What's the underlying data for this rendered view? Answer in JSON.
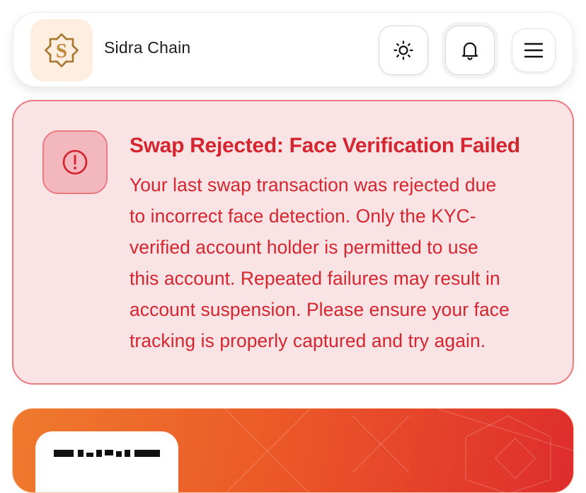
{
  "header": {
    "app_name": "Sidra Chain",
    "logo_icon": "sidra-star-logo-icon",
    "buttons": [
      {
        "name": "theme-toggle",
        "icon": "sun-icon"
      },
      {
        "name": "notifications",
        "icon": "bell-icon"
      },
      {
        "name": "menu",
        "icon": "hamburger-menu-icon"
      }
    ]
  },
  "alert": {
    "icon": "exclamation-circle-icon",
    "title": "Swap Rejected: Face Verification Failed",
    "body_lines": [
      "Your last swap transaction was rejected due",
      "to incorrect face detection. Only the KYC-",
      "verified account holder is permitted to use",
      "this account. Repeated failures may result in",
      "account suspension. Please ensure your face",
      "tracking is properly captured and try again."
    ]
  },
  "card": {
    "icon": "qr-code-icon"
  },
  "colors": {
    "alert_text": "#d42630",
    "alert_bg": "#fae3e4",
    "alert_border": "#ea7a82",
    "card_gradient_start": "#ee7a2d",
    "card_gradient_end": "#de2d2d",
    "logo_gold": "#b8863a"
  }
}
